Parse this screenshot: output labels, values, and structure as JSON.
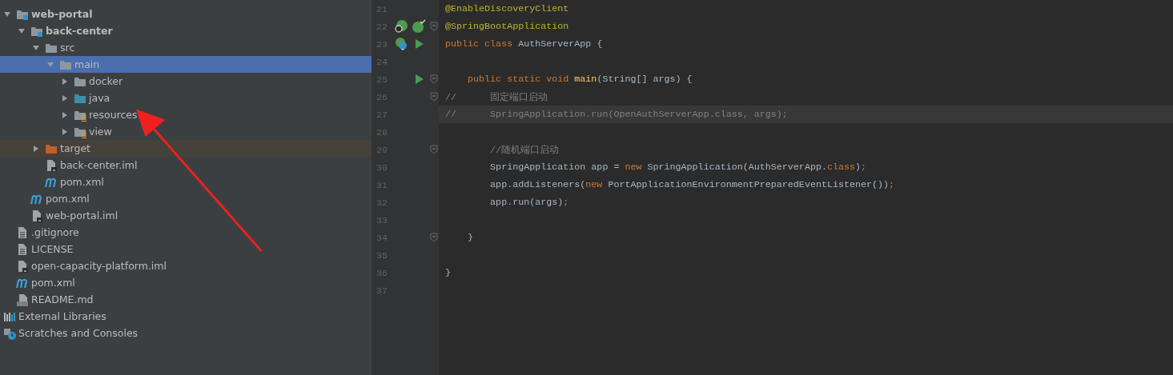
{
  "project_tree": [
    {
      "name": "web-portal",
      "kind": "module",
      "expanded": true,
      "selected": false,
      "children": [
        {
          "name": "back-center",
          "kind": "module",
          "expanded": true,
          "selected": false,
          "children": [
            {
              "name": "src",
              "kind": "folder",
              "expanded": true,
              "selected": false,
              "children": [
                {
                  "name": "main",
                  "kind": "folder",
                  "expanded": true,
                  "selected": true,
                  "children": [
                    {
                      "name": "docker",
                      "kind": "folder",
                      "expanded": false,
                      "selected": false
                    },
                    {
                      "name": "java",
                      "kind": "source-folder",
                      "expanded": false,
                      "selected": false
                    },
                    {
                      "name": "resources",
                      "kind": "resource-folder",
                      "expanded": false,
                      "selected": false
                    },
                    {
                      "name": "view",
                      "kind": "resource-folder",
                      "expanded": false,
                      "selected": false
                    }
                  ]
                }
              ]
            },
            {
              "name": "target",
              "kind": "excluded-folder",
              "expanded": false,
              "selected": false
            },
            {
              "name": "back-center.iml",
              "kind": "iml",
              "selected": false
            },
            {
              "name": "pom.xml",
              "kind": "maven",
              "selected": false
            }
          ]
        },
        {
          "name": "pom.xml",
          "kind": "maven",
          "selected": false
        },
        {
          "name": "web-portal.iml",
          "kind": "iml",
          "selected": false
        }
      ]
    },
    {
      "name": ".gitignore",
      "kind": "text",
      "selected": false
    },
    {
      "name": "LICENSE",
      "kind": "text",
      "selected": false
    },
    {
      "name": "open-capacity-platform.iml",
      "kind": "iml",
      "selected": false
    },
    {
      "name": "pom.xml",
      "kind": "maven",
      "selected": false
    },
    {
      "name": "README.md",
      "kind": "markdown",
      "selected": false
    },
    {
      "name": "External Libraries",
      "kind": "libraries",
      "selected": false
    },
    {
      "name": "Scratches and Consoles",
      "kind": "scratches",
      "selected": false
    }
  ],
  "editor": {
    "lines": [
      {
        "number": "21",
        "current": false,
        "fold": false,
        "tokens": [
          {
            "kind": "annotation",
            "text": "@EnableDiscoveryClient"
          }
        ]
      },
      {
        "number": "22",
        "current": false,
        "gutter": [
          {
            "kind": "spring-search"
          },
          {
            "kind": "spring-check"
          }
        ],
        "fold": true,
        "tokens": [
          {
            "kind": "annotation",
            "text": "@SpringBootApplication"
          }
        ]
      },
      {
        "number": "23",
        "current": false,
        "gutter": [
          {
            "kind": "spring-class"
          },
          {
            "kind": "run"
          }
        ],
        "fold": false,
        "tokens": [
          {
            "kind": "keyword",
            "text": "public class"
          },
          {
            "kind": "plain",
            "text": " AuthServerApp {"
          }
        ]
      },
      {
        "number": "24",
        "current": false,
        "fold": false
      },
      {
        "number": "25",
        "current": false,
        "gutter": [
          {
            "kind": "blank"
          },
          {
            "kind": "run"
          }
        ],
        "fold": true,
        "tokens": [
          {
            "kind": "keyword",
            "text": "    public static void "
          },
          {
            "kind": "method",
            "text": "main"
          },
          {
            "kind": "plain",
            "text": "(String[] args) {"
          }
        ]
      },
      {
        "number": "26",
        "current": false,
        "fold": true,
        "tokens": [
          {
            "kind": "comment",
            "text": "//      固定端口启动"
          }
        ]
      },
      {
        "number": "27",
        "current": true,
        "fold": false,
        "tokens": [
          {
            "kind": "comment",
            "text": "//      SpringApplication.run(OpenAuthServerApp.class, args);"
          }
        ]
      },
      {
        "number": "28",
        "current": false,
        "fold": false
      },
      {
        "number": "29",
        "current": false,
        "fold": true,
        "tokens": [
          {
            "kind": "comment",
            "text": "        //随机端口启动"
          }
        ]
      },
      {
        "number": "30",
        "current": false,
        "fold": false,
        "tokens": [
          {
            "kind": "plain",
            "text": "        SpringApplication app = "
          },
          {
            "kind": "keyword",
            "text": "new"
          },
          {
            "kind": "plain",
            "text": " SpringApplication(AuthServerApp."
          },
          {
            "kind": "keyword",
            "text": "class"
          },
          {
            "kind": "plain",
            "text": ")"
          },
          {
            "kind": "keyword",
            "text": ";"
          }
        ]
      },
      {
        "number": "31",
        "current": false,
        "fold": false,
        "tokens": [
          {
            "kind": "plain",
            "text": "        app.addListeners("
          },
          {
            "kind": "keyword",
            "text": "new"
          },
          {
            "kind": "plain",
            "text": " PortApplicationEnvironmentPreparedEventListener())"
          },
          {
            "kind": "keyword",
            "text": ";"
          }
        ]
      },
      {
        "number": "32",
        "current": false,
        "fold": false,
        "tokens": [
          {
            "kind": "plain",
            "text": "        app.run(args)"
          },
          {
            "kind": "keyword",
            "text": ";"
          }
        ]
      },
      {
        "number": "33",
        "current": false,
        "fold": false
      },
      {
        "number": "34",
        "current": false,
        "fold": true,
        "tokens": [
          {
            "kind": "plain",
            "text": "    }"
          }
        ]
      },
      {
        "number": "35",
        "current": false,
        "fold": false
      },
      {
        "number": "36",
        "current": false,
        "fold": false,
        "tokens": [
          {
            "kind": "plain",
            "text": "}"
          }
        ]
      },
      {
        "number": "37",
        "current": false,
        "fold": false
      }
    ]
  }
}
